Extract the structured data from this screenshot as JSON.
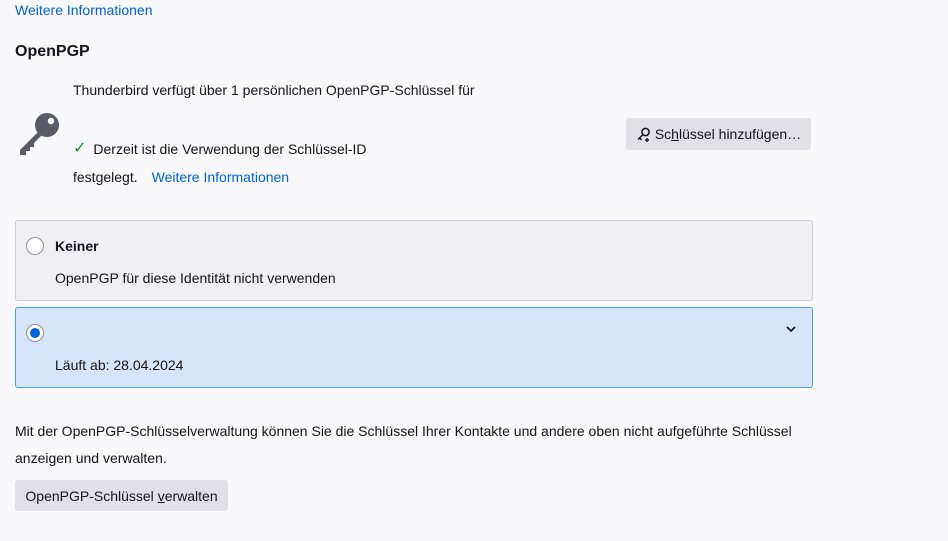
{
  "top_link": "Weitere Informationen",
  "openpgp": {
    "heading": "OpenPGP",
    "summary": "Thunderbird verfügt über 1 persönlichen OpenPGP-Schlüssel für",
    "status_text": "Derzeit ist die Verwendung der Schlüssel-ID",
    "status_text_cont": "festgelegt.",
    "status_link": "Weitere Informationen",
    "add_key_button": {
      "before": "Sc",
      "accesskey": "h",
      "after": "lüssel hinzufügen…"
    },
    "options": [
      {
        "title": "Keiner",
        "description": "OpenPGP für diese Identität nicht verwenden",
        "selected": false
      },
      {
        "title": "",
        "description": "Läuft ab: 28.04.2024",
        "selected": true
      }
    ],
    "info_text": "Mit der OpenPGP-Schlüsselverwaltung können Sie die Schlüssel Ihrer Kontakte und andere oben nicht aufgeführte Schlüssel anzeigen und verwalten.",
    "manage_button": {
      "before": "OpenPGP-Schlüssel ",
      "accesskey": "v",
      "after": "erwalten"
    }
  },
  "colors": {
    "accent": "#0061e0",
    "selected_bg": "#d5e6fa",
    "check": "#1b8a2e"
  },
  "icons": [
    "key-icon",
    "check-icon",
    "key-add-icon",
    "chevron-down-icon"
  ]
}
